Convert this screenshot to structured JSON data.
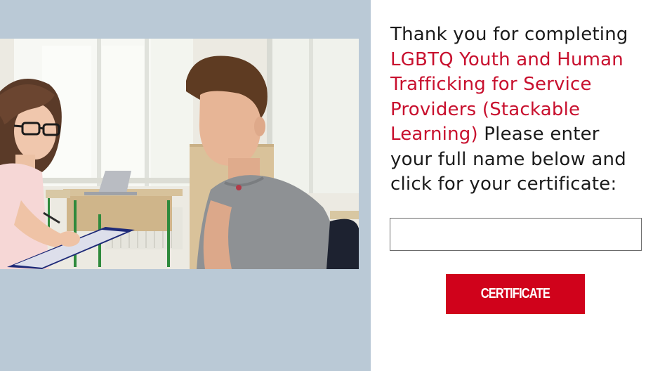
{
  "message": {
    "intro": "Thank you for completing ",
    "course_title": "LGBTQ Youth and Human Trafficking for Service Providers (Stackable Learning)",
    "instruction": " Please enter your full name below and click for your certificate:"
  },
  "name_input": {
    "value": "",
    "placeholder": ""
  },
  "certificate_button": {
    "label": "CERTIFICATE"
  },
  "colors": {
    "accent": "#d0021b",
    "left_panel_bg": "#bac9d6",
    "text": "#1b1b1b"
  },
  "photo": {
    "subject": "teacher-and-student-photo"
  }
}
